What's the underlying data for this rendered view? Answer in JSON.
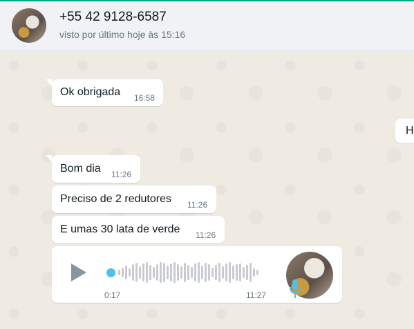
{
  "header": {
    "contact_name": "+55 42 9128-6587",
    "status": "visto por último hoje às 15:16"
  },
  "messages": [
    {
      "text": "Ok obrigada",
      "time": "16:58"
    },
    {
      "text": "Bom dia",
      "time": "11:26"
    },
    {
      "text": "Preciso de 2 redutores",
      "time": "11:26"
    },
    {
      "text": "E umas 30 lata de verde",
      "time": "11:26"
    }
  ],
  "outgoing_partial": {
    "text": "H"
  },
  "voice": {
    "duration": "0:17",
    "time": "11:27"
  },
  "colors": {
    "accent": "#00a884",
    "progress_dot": "#53bdeb",
    "bubble": "#ffffff",
    "background": "#efeae2"
  },
  "icons": {
    "play": "play-icon",
    "mic": "mic-icon"
  }
}
